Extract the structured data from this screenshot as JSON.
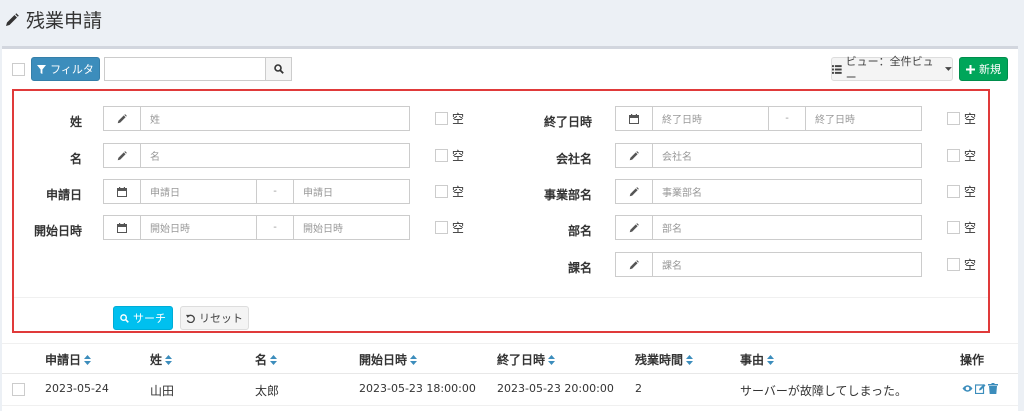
{
  "page": {
    "title": "残業申請"
  },
  "toolbar": {
    "filter_label": "フィルタ",
    "view_label": "ビュー：全件ビュー",
    "new_label": "新規"
  },
  "filters": {
    "left": [
      {
        "label": "姓",
        "placeholder": "姓",
        "empty_label": "空"
      },
      {
        "label": "名",
        "placeholder": "名",
        "empty_label": "空"
      },
      {
        "label": "申請日",
        "from_placeholder": "申請日",
        "to_placeholder": "申請日",
        "separator": "-",
        "empty_label": "空"
      },
      {
        "label": "開始日時",
        "from_placeholder": "開始日時",
        "to_placeholder": "開始日時",
        "separator": "-",
        "empty_label": "空"
      }
    ],
    "right": [
      {
        "label": "終了日時",
        "from_placeholder": "終了日時",
        "to_placeholder": "終了日時",
        "separator": "-",
        "empty_label": "空"
      },
      {
        "label": "会社名",
        "placeholder": "会社名",
        "empty_label": "空"
      },
      {
        "label": "事業部名",
        "placeholder": "事業部名",
        "empty_label": "空"
      },
      {
        "label": "部名",
        "placeholder": "部名",
        "empty_label": "空"
      },
      {
        "label": "課名",
        "placeholder": "課名",
        "empty_label": "空"
      }
    ],
    "search_label": "サーチ",
    "reset_label": "リセット"
  },
  "table": {
    "columns": [
      "申請日",
      "姓",
      "名",
      "開始日時",
      "終了日時",
      "残業時間",
      "事由",
      "操作"
    ],
    "rows": [
      {
        "date": "2023-05-24",
        "last": "山田",
        "first": "太郎",
        "start": "2023-05-23 18:00:00",
        "end": "2023-05-23 20:00:00",
        "hours": "2",
        "reason": "サーバーが故障してしまった。"
      }
    ]
  },
  "colors": {
    "primary": "#3c8dbc",
    "success": "#00a65a",
    "info": "#00c0ef",
    "highlight": "#e03a3a"
  }
}
